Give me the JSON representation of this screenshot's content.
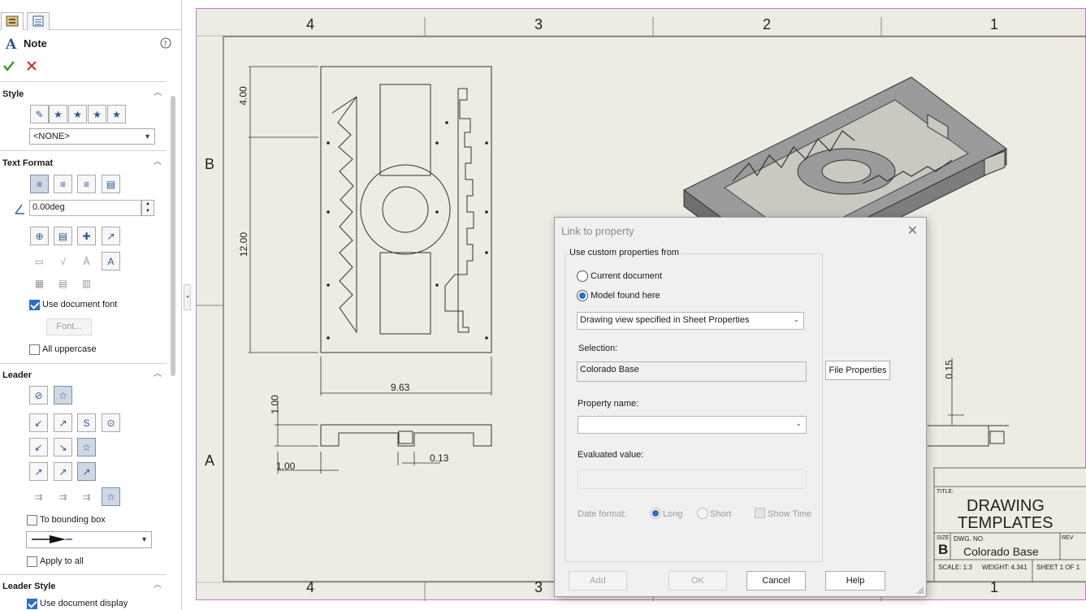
{
  "property_manager": {
    "title": "Note",
    "help_icon": "help-icon",
    "ok_icon": "checkmark-icon",
    "cancel_icon": "x-icon",
    "style": {
      "title": "Style",
      "dropdown_value": "<NONE>"
    },
    "text_format": {
      "title": "Text Format",
      "angle_value": "0.00deg",
      "use_document_font": "Use document font",
      "font_button": "Font...",
      "all_uppercase": "All uppercase"
    },
    "leader": {
      "title": "Leader",
      "to_bounding_box": "To bounding box",
      "apply_to_all": "Apply to all"
    },
    "leader_style": {
      "title": "Leader Style",
      "use_document_display": "Use document display"
    }
  },
  "sheet": {
    "zones_top": [
      "4",
      "3",
      "2",
      "1"
    ],
    "zones_bottom": [
      "4",
      "3",
      "1"
    ],
    "rows": [
      "B",
      "A"
    ],
    "dims": {
      "height_top": "4.00",
      "height_main": "12.00",
      "width": "9.63",
      "side_height": "1.00",
      "side_width": "1.00",
      "slot": "0.13",
      "right_dim": "0.15"
    },
    "title_block": {
      "title_label": "TITLE:",
      "title_line1": "DRAWING",
      "title_line2": "TEMPLATES",
      "size_label": "SIZE",
      "size_value": "B",
      "dwg_label": "DWG.  NO.",
      "dwg_value": "Colorado Base",
      "rev_label": "REV",
      "scale": "SCALE: 1:3",
      "weight": "WEIGHT: 4.341",
      "sheet": "SHEET 1 OF 1"
    }
  },
  "dialog": {
    "title": "Link to property",
    "group_label": "Use custom properties from",
    "radio_current": "Current document",
    "radio_model": "Model found here",
    "model_dropdown": "Drawing view specified in Sheet Properties",
    "selection_label": "Selection:",
    "selection_value": "Colorado Base",
    "file_properties": "File Properties",
    "property_name_label": "Property name:",
    "property_name_value": "",
    "evaluated_label": "Evaluated value:",
    "evaluated_value": "",
    "date_format_label": "Date format:",
    "date_long": "Long",
    "date_short": "Short",
    "show_time": "Show Time",
    "btn_add": "Add",
    "btn_ok": "OK",
    "btn_cancel": "Cancel",
    "btn_help": "Help"
  }
}
